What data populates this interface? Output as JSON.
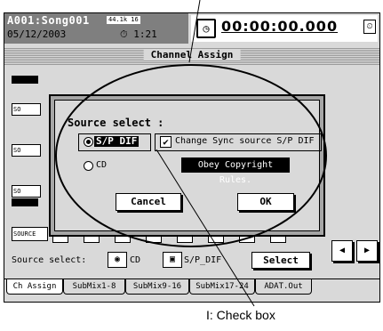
{
  "header": {
    "song": "A001:Song001",
    "fs_badge": "44.1k 16",
    "date": "05/12/2003",
    "clock_icon": "clock-icon",
    "time_small": "1:21",
    "time_main": "00:00:00.000",
    "end_icon": "timer-icon"
  },
  "title": "Channel Assign",
  "background_rows": [
    "SO",
    "SO",
    "SO"
  ],
  "dialog": {
    "title": "Source select :",
    "option1_label": "S/P DIF",
    "option1_selected": true,
    "option2_label": "CD",
    "option2_selected": false,
    "checkbox_label": "Change Sync source S/P DIF",
    "checkbox_checked": true,
    "checkbox_mark": "✔",
    "notice": "Obey Copyright Rules.",
    "cancel_label": "Cancel",
    "ok_label": "OK"
  },
  "source_row": {
    "label": "SOURCE",
    "cells": [
      "1",
      "1",
      "1",
      "1",
      "1",
      "1",
      "1",
      "1"
    ]
  },
  "source_select": {
    "label": "Source select:",
    "cd_label": "CD",
    "spdif_label": "S/P_DIF",
    "select_button": "Select"
  },
  "tabs": [
    "Ch Assign",
    "SubMix1-8",
    "SubMix9-16",
    "SubMix17-24",
    "ADAT.Out"
  ],
  "active_tab": "Ch Assign",
  "callout": "I: Check box"
}
